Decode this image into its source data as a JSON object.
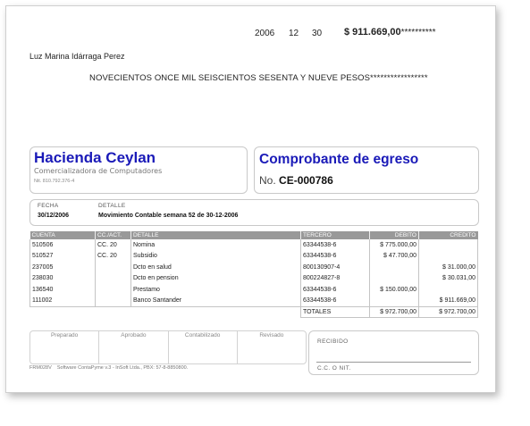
{
  "check": {
    "year": "2006",
    "month": "12",
    "day": "30",
    "amount": "$ 911.669,00",
    "amount_stars": "**********",
    "payee": "Luz Marina Idárraga Perez",
    "amount_words": "NOVECIENTOS ONCE MIL SEISCIENTOS SESENTA Y NUEVE PESOS*****************"
  },
  "company": {
    "name": "Hacienda Ceylan",
    "subtitle": "Comercializadora de Computadores",
    "nit": "Nit. 810.792.376-4"
  },
  "voucher": {
    "title": "Comprobante de egreso",
    "number_label": "No.",
    "number": "CE-000786"
  },
  "info": {
    "date_label": "FECHA",
    "date": "30/12/2006",
    "detail_label": "DETALLE",
    "detail": "Movimiento Contable semana 52 de 30-12-2006"
  },
  "ledger": {
    "headers": [
      "CUENTA",
      "CC./ACT.",
      "DETALLE",
      "TERCERO",
      "DEBITO",
      "CREDITO"
    ],
    "rows": [
      [
        "510506",
        "CC. 20",
        "Nomina",
        "63344538-6",
        "$ 775.000,00",
        ""
      ],
      [
        "510527",
        "CC. 20",
        "Subsidio",
        "63344538-6",
        "$ 47.700,00",
        ""
      ],
      [
        "237005",
        "",
        "Dcto en salud",
        "800130907-4",
        "",
        "$ 31.000,00"
      ],
      [
        "238030",
        "",
        "Dcto en pension",
        "800224827-8",
        "",
        "$ 30.031,00"
      ],
      [
        "136540",
        "",
        "Prestamo",
        "63344538-6",
        "$ 150.000,00",
        ""
      ],
      [
        "111002",
        "",
        "Banco Santander",
        "63344538-6",
        "",
        "$ 911.669,00"
      ]
    ],
    "totals_label": "TOTALES",
    "total_debit": "$ 972.700,00",
    "total_credit": "$ 972.700,00"
  },
  "signatures": [
    "Preparado",
    "Aprobado",
    "Contabilizado",
    "Revisado"
  ],
  "received": {
    "label": "RECIBIDO",
    "cc_label": "C.C. O NIT."
  },
  "footer": {
    "form_code": "FRM028V",
    "software": "Software ContaPyme v.3 - InSoft Ltda., PBX: 57-8-8850800."
  }
}
